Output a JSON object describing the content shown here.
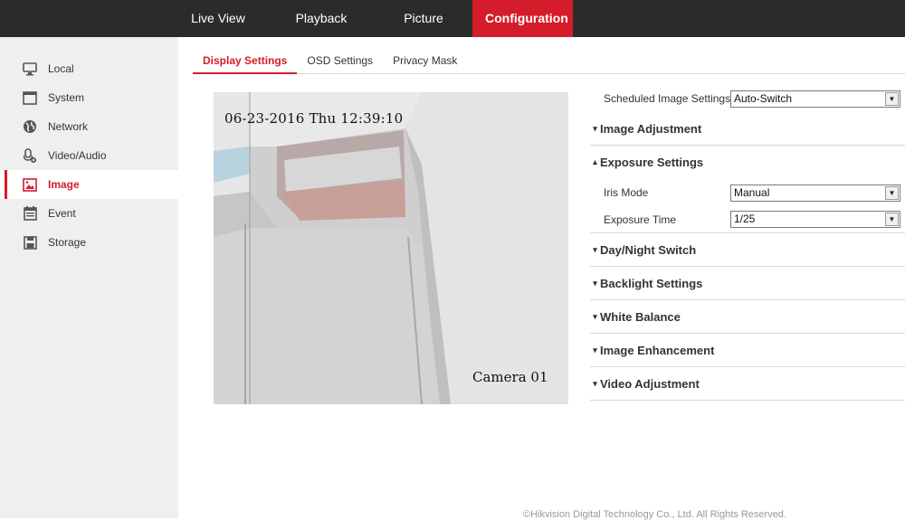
{
  "topnav": {
    "items": [
      {
        "label": "Live View"
      },
      {
        "label": "Playback"
      },
      {
        "label": "Picture"
      },
      {
        "label": "Configuration"
      }
    ]
  },
  "sidebar": {
    "items": [
      {
        "label": "Local",
        "icon": "monitor-icon"
      },
      {
        "label": "System",
        "icon": "window-icon"
      },
      {
        "label": "Network",
        "icon": "globe-icon"
      },
      {
        "label": "Video/Audio",
        "icon": "microphone-icon"
      },
      {
        "label": "Image",
        "icon": "image-icon"
      },
      {
        "label": "Event",
        "icon": "calendar-icon"
      },
      {
        "label": "Storage",
        "icon": "floppy-icon"
      }
    ]
  },
  "subtabs": {
    "items": [
      {
        "label": "Display Settings"
      },
      {
        "label": "OSD Settings"
      },
      {
        "label": "Privacy Mask"
      }
    ]
  },
  "video": {
    "osd_time": "06-23-2016 Thu 12:39:10",
    "osd_camera": "Camera 01"
  },
  "panel": {
    "scheduled_label": "Scheduled Image Settings",
    "scheduled_value": "Auto-Switch",
    "image_adjustment": "Image Adjustment",
    "exposure_settings": "Exposure Settings",
    "iris_mode_label": "Iris Mode",
    "iris_mode_value": "Manual",
    "exposure_time_label": "Exposure Time",
    "exposure_time_value": "1/25",
    "day_night": "Day/Night Switch",
    "backlight": "Backlight Settings",
    "white_balance": "White Balance",
    "image_enhancement": "Image Enhancement",
    "video_adjustment": "Video Adjustment"
  },
  "footer": {
    "copyright": "©Hikvision Digital Technology Co., Ltd. All Rights Reserved."
  },
  "colors": {
    "accent": "#d51c2a",
    "topbar": "#2b2b2b",
    "sidebar": "#efefef"
  }
}
